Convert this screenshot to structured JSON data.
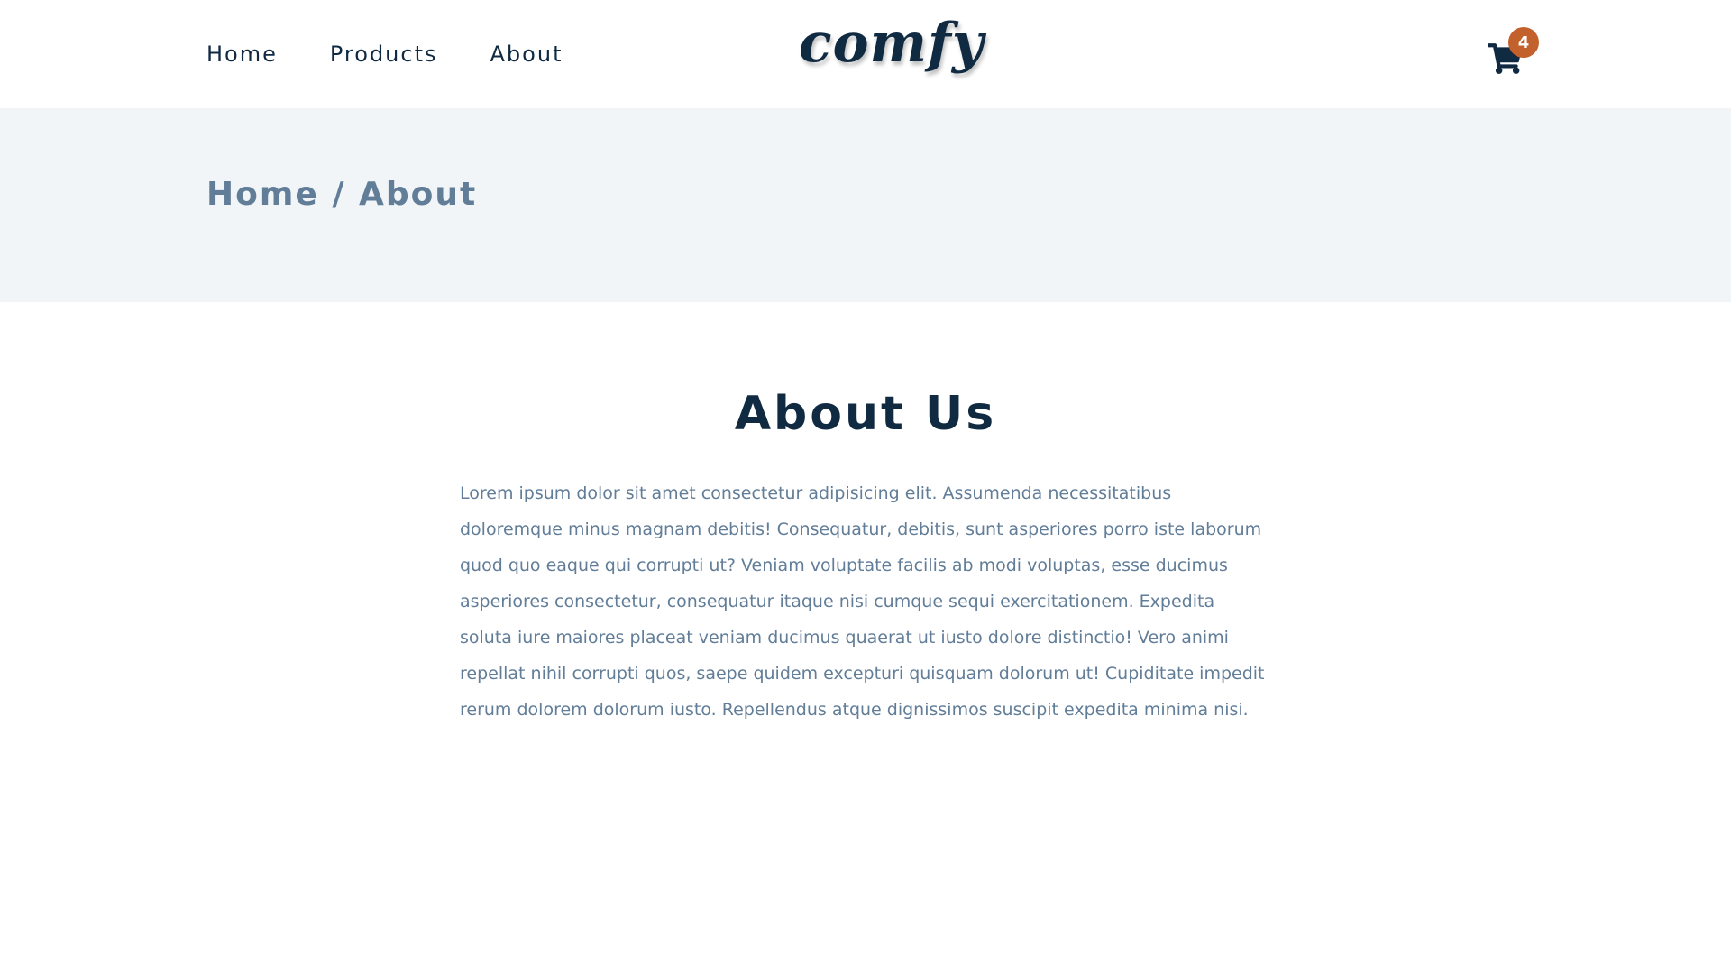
{
  "nav": {
    "links": [
      "Home",
      "Products",
      "About"
    ],
    "logo": "comfy",
    "cart_count": "4"
  },
  "hero": {
    "breadcrumb": "Home / About"
  },
  "about": {
    "title": "About Us",
    "text": "Lorem ipsum dolor sit amet consectetur adipisicing elit. Assumenda necessitatibus doloremque minus magnam debitis! Consequatur, debitis, sunt asperiores porro iste laborum quod quo eaque qui corrupti ut? Veniam voluptate facilis ab modi voluptas, esse ducimus asperiores consectetur, consequatur itaque nisi cumque sequi exercitationem. Expedita soluta iure maiores placeat veniam ducimus quaerat ut iusto dolore distinctio! Vero animi repellat nihil corrupti quos, saepe quidem excepturi quisquam dolorum ut! Cupiditate impedit rerum dolorem dolorum iusto. Repellendus atque dignissimos suscipit expedita minima nisi."
  },
  "colors": {
    "primary_dark": "#102a42",
    "muted": "#617d98",
    "hero_bg": "#f1f5f8",
    "badge": "#c2612c"
  },
  "icons": {
    "cart": "shopping-cart-icon"
  }
}
